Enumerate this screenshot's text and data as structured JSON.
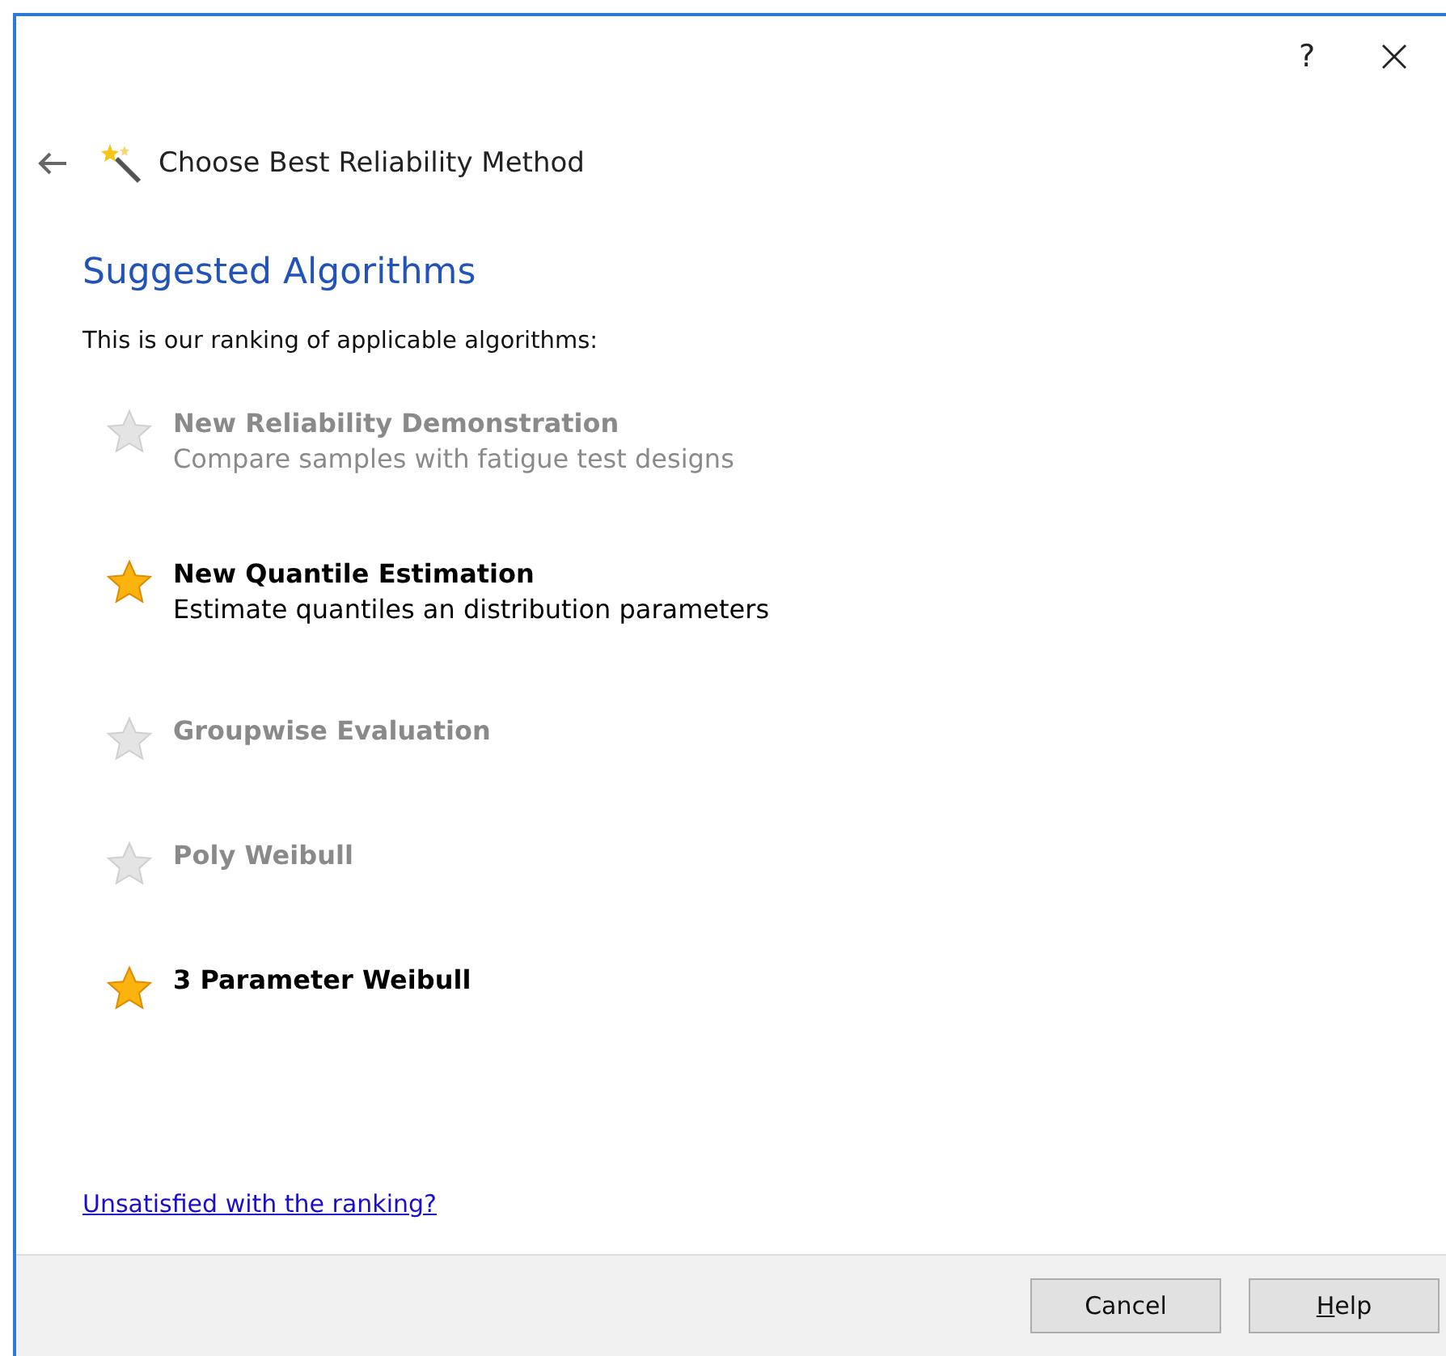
{
  "titlebar": {
    "help": "?"
  },
  "header": {
    "title": "Choose Best Reliability Method"
  },
  "heading": "Suggested Algorithms",
  "intro": "This is our ranking of applicable algorithms:",
  "algorithms": [
    {
      "name": "New Reliability Demonstration",
      "description": "Compare samples with fatigue test designs",
      "recommended": false
    },
    {
      "name": "New Quantile Estimation",
      "description": "Estimate quantiles an distribution parameters",
      "recommended": true
    },
    {
      "name": "Groupwise Evaluation",
      "recommended": false
    },
    {
      "name": "Poly Weibull",
      "recommended": false
    },
    {
      "name": "3 Parameter Weibull",
      "recommended": true
    }
  ],
  "link": "Unsatisfied with the ranking?",
  "buttons": [
    {
      "label": "Cancel",
      "mnemonic": false
    },
    {
      "label": "Help",
      "mnemonic": true
    }
  ]
}
